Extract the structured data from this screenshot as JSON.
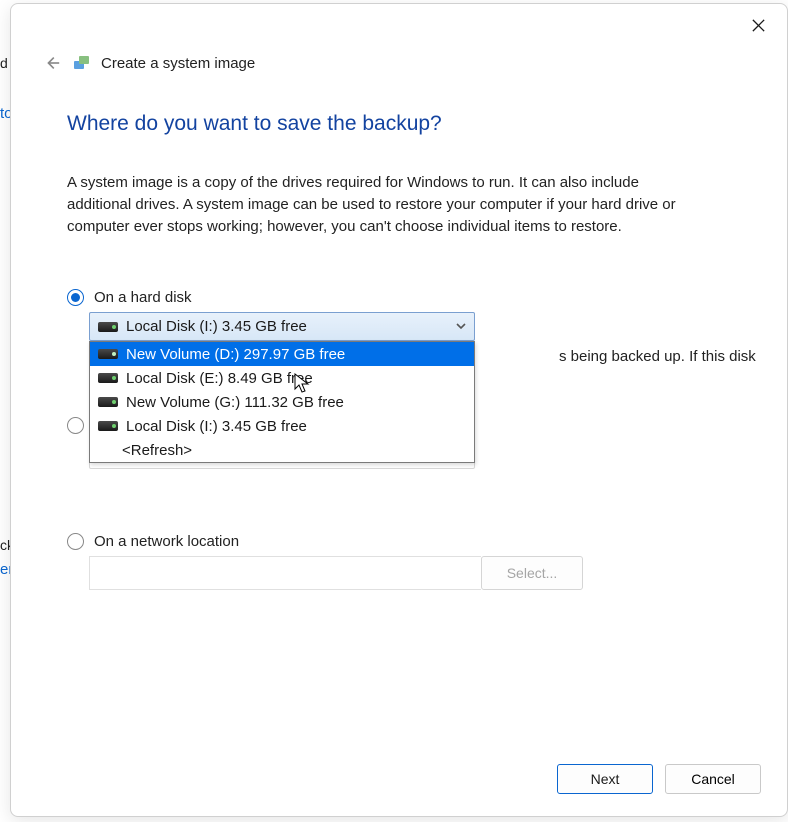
{
  "leftEdge": {
    "a": "d",
    "b": "to",
    "c": "cku",
    "d": "er"
  },
  "header": {
    "title": "Create a system image"
  },
  "headline": "Where do you want to save the backup?",
  "description": "A system image is a copy of the drives required for Windows to run. It can also include additional drives. A system image can be used to restore your computer if your hard drive or computer ever stops working; however, you can't choose individual items to restore.",
  "options": {
    "hardDisk": {
      "label": "On a hard disk",
      "selectedText": "Local Disk (I:)  3.45 GB free",
      "behindText": "s being backed up. If this disk",
      "dropdown": [
        {
          "label": "New Volume (D:)  297.97 GB free",
          "highlight": true
        },
        {
          "label": "Local Disk (E:)  8.49 GB free",
          "highlight": false
        },
        {
          "label": "New Volume (G:)  111.32 GB free",
          "highlight": false
        },
        {
          "label": "Local Disk (I:)  3.45 GB free",
          "highlight": false
        },
        {
          "label": "<Refresh>",
          "refresh": true
        }
      ]
    },
    "dvd": {
      "label": ""
    },
    "network": {
      "label": "On a network location",
      "selectButton": "Select..."
    }
  },
  "footer": {
    "next": "Next",
    "cancel": "Cancel"
  }
}
